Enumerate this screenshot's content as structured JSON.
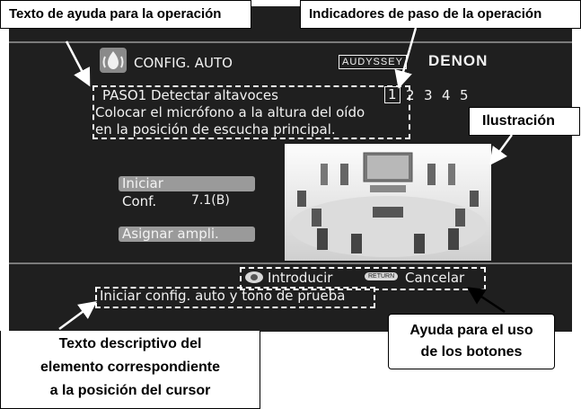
{
  "callouts": {
    "help_text": "Texto de ayuda para la operación",
    "step_indicators": "Indicadores de paso de la operación",
    "illustration": "Ilustración",
    "descriptive_text": [
      "Texto descriptivo del",
      "elemento correspondiente",
      "a la posición del cursor"
    ],
    "button_help": [
      "Ayuda para el uso",
      "de los botones"
    ]
  },
  "screen": {
    "title": "CONFIG. AUTO",
    "brand_audyssey": "AUDYSSEY",
    "brand_denon": "DENON",
    "step_title": "PASO1 Detectar altavoces",
    "instructions": [
      "Colocar el micrófono a la altura del oído",
      "en la posición de escucha principal."
    ],
    "steps": [
      "1",
      "2",
      "3",
      "4",
      "5"
    ],
    "current_step": 1,
    "menu": {
      "start": "Iniciar",
      "conf_label": "Conf.",
      "conf_value": "7.1(B)",
      "assign": "Asignar ampli."
    },
    "buttons": {
      "enter": "Introducir",
      "return_badge": "RETURN",
      "cancel": "Cancelar"
    },
    "description": "Iniciar config. auto y tono de prueba"
  },
  "colors": {
    "screen_bg": "#1f1f1f",
    "text": "#f2f2f2",
    "highlight": "#9a9a9a"
  }
}
